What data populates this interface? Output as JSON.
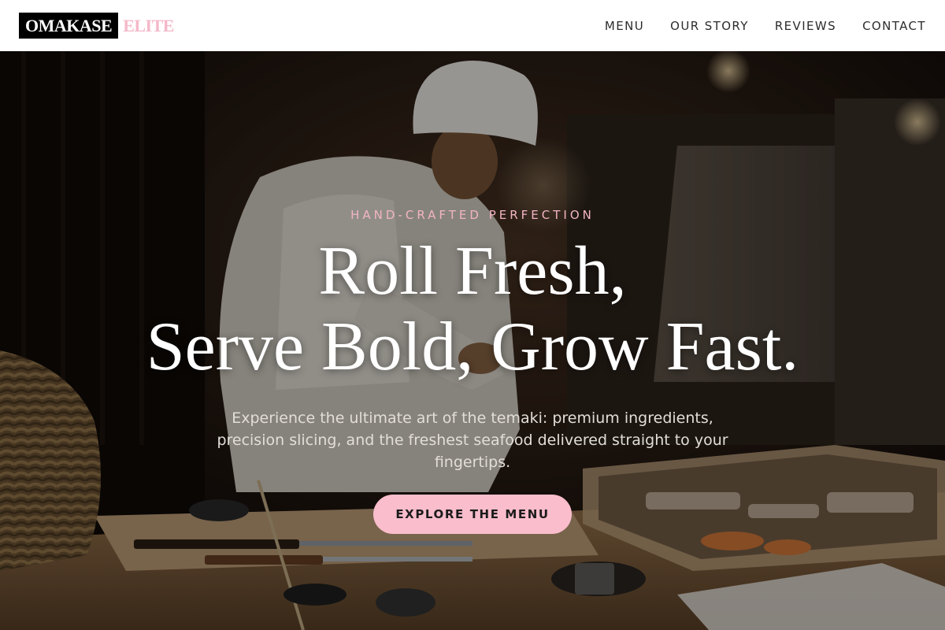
{
  "brand": {
    "name_primary": "OMAKASE",
    "name_accent": "ELITE",
    "accent_color": "#f5b8c8"
  },
  "nav": {
    "items": [
      {
        "label": "MENU"
      },
      {
        "label": "OUR STORY"
      },
      {
        "label": "REVIEWS"
      },
      {
        "label": "CONTACT"
      }
    ]
  },
  "hero": {
    "eyebrow": "HAND-CRAFTED PERFECTION",
    "headline_line1": "Roll Fresh,",
    "headline_line2": "Serve Bold, Grow Fast.",
    "subtext": "Experience the ultimate art of the temaki: premium ingredients, precision slicing, and the freshest seafood delivered straight to your fingertips.",
    "cta_label": "EXPLORE THE MENU",
    "cta_color": "#f9bdcc",
    "background_image": "sushi-chef-kitchen-photo"
  }
}
